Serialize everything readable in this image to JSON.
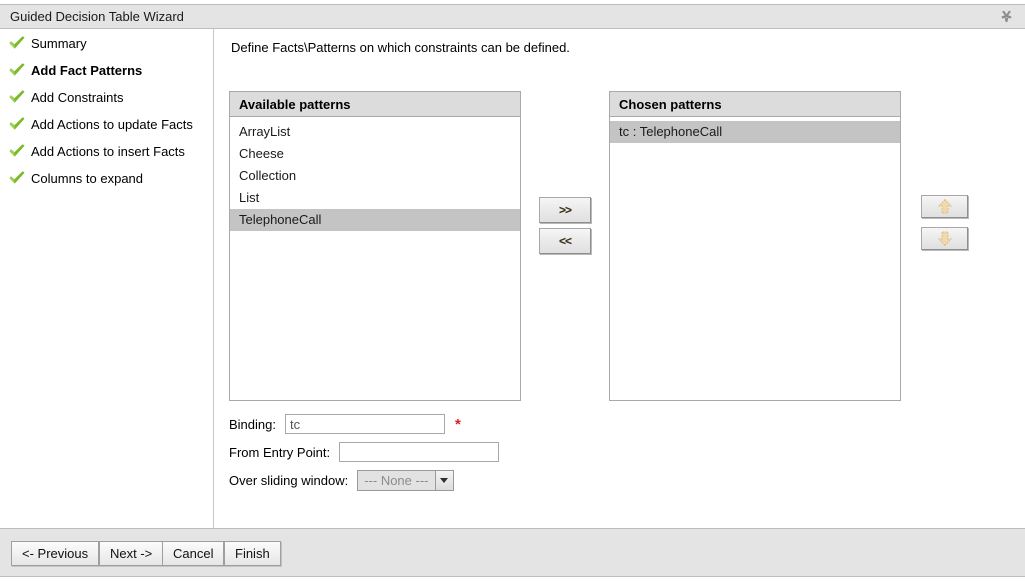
{
  "window": {
    "title": "Guided Decision Table Wizard",
    "close_icon": "close-icon"
  },
  "sidebar": {
    "items": [
      {
        "label": "Summary",
        "icon": "check-icon",
        "active": false
      },
      {
        "label": "Add Fact Patterns",
        "icon": "check-icon",
        "active": true
      },
      {
        "label": "Add Constraints",
        "icon": "check-icon",
        "active": false
      },
      {
        "label": "Add Actions to update Facts",
        "icon": "check-icon",
        "active": false
      },
      {
        "label": "Add Actions to insert Facts",
        "icon": "check-icon",
        "active": false
      },
      {
        "label": "Columns to expand",
        "icon": "check-icon",
        "active": false
      }
    ]
  },
  "main": {
    "instruction": "Define Facts\\Patterns on which constraints can be defined.",
    "available": {
      "header": "Available patterns",
      "items": [
        {
          "label": "ArrayList",
          "selected": false
        },
        {
          "label": "Cheese",
          "selected": false
        },
        {
          "label": "Collection",
          "selected": false
        },
        {
          "label": "List",
          "selected": false
        },
        {
          "label": "TelephoneCall",
          "selected": true
        }
      ]
    },
    "chosen": {
      "header": "Chosen patterns",
      "items": [
        {
          "label": "tc : TelephoneCall",
          "selected": true
        }
      ]
    },
    "transfer": {
      "add_label": ">>",
      "remove_label": "<<"
    },
    "reorder": {
      "up_icon": "arrow-up-icon",
      "down_icon": "arrow-down-icon"
    },
    "form": {
      "binding_label": "Binding:",
      "binding_value": "tc",
      "binding_required_marker": "*",
      "entry_point_label": "From Entry Point:",
      "entry_point_value": "",
      "sliding_window_label": "Over sliding window:",
      "sliding_window_value": "--- None ---",
      "sliding_window_options": [
        "--- None ---"
      ]
    }
  },
  "footer": {
    "previous_label": "<- Previous",
    "next_label": "Next ->",
    "cancel_label": "Cancel",
    "finish_label": "Finish"
  },
  "colors": {
    "titlebar_bg": "#e4e4e4",
    "panel_header_bg": "#dcdcdc",
    "selection_bg": "#c4c4c4",
    "required_marker": "#d81f1f",
    "check_green": "#79b92b",
    "arrow_tan": "#e8c98b"
  }
}
